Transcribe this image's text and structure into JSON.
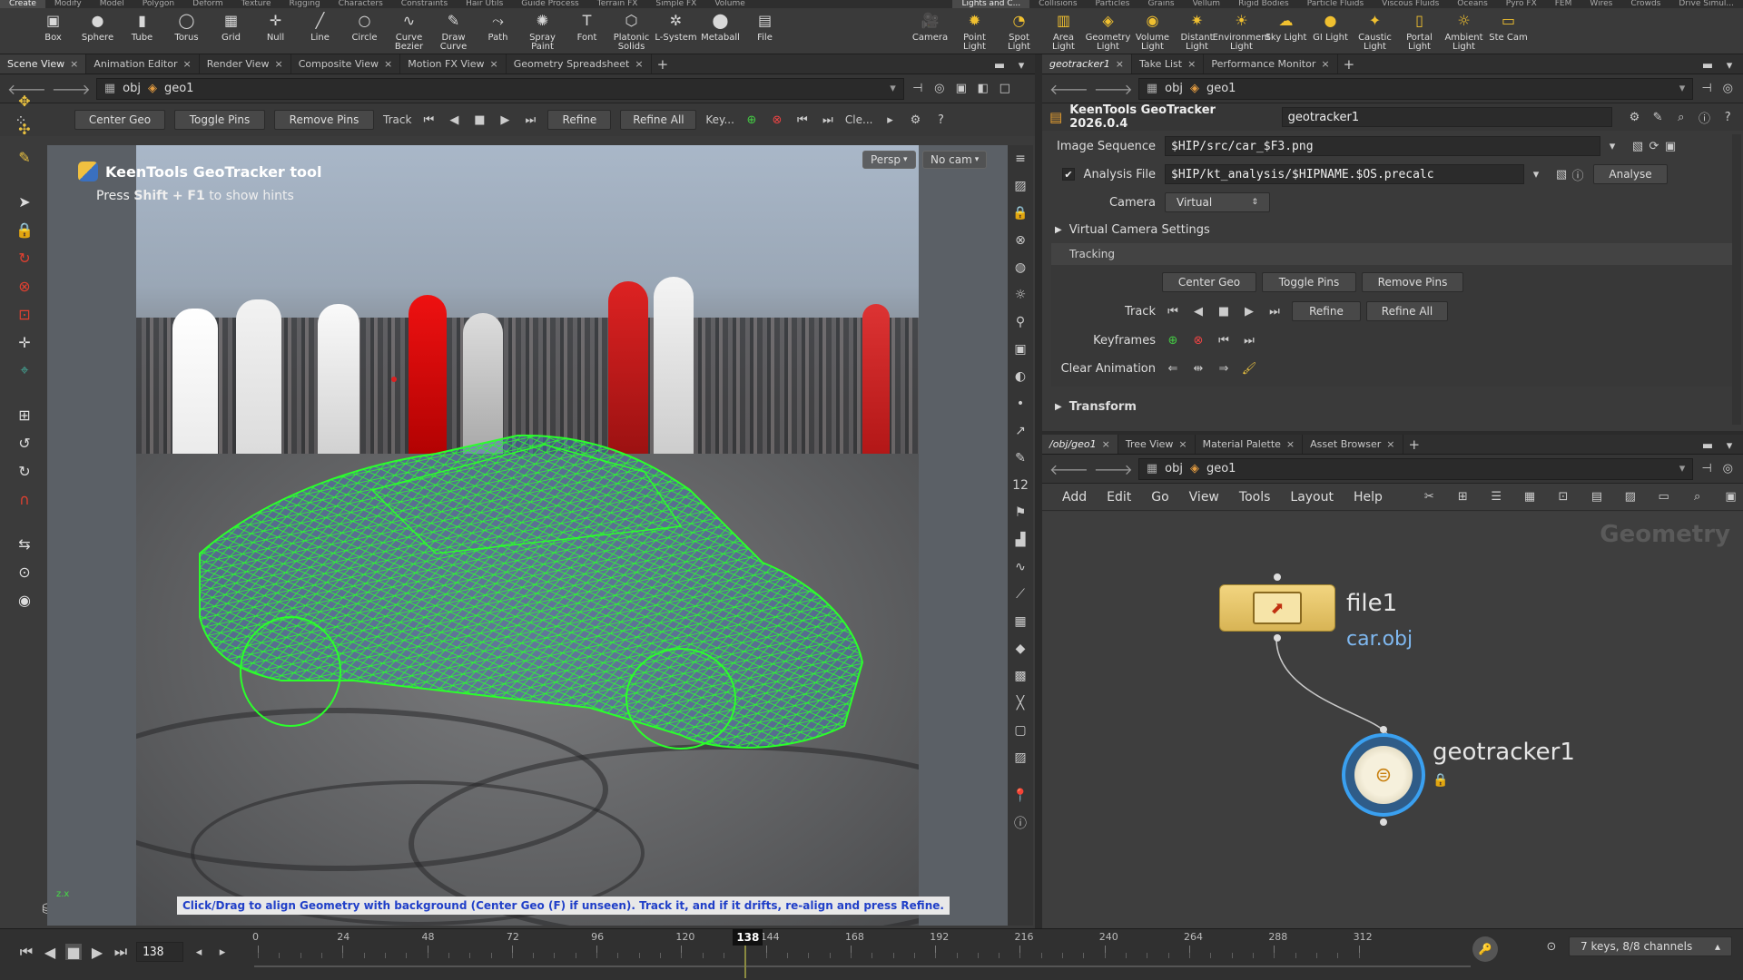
{
  "shelf": {
    "tabs_left": [
      "Create",
      "Modify",
      "Model",
      "Polygon",
      "Deform",
      "Texture",
      "Rigging",
      "Characters",
      "Constraints",
      "Hair Utils",
      "Guide Process",
      "Terrain FX",
      "Simple FX",
      "Volume"
    ],
    "tabs_right": [
      "Lights and C...",
      "Collisions",
      "Particles",
      "Grains",
      "Vellum",
      "Rigid Bodies",
      "Particle Fluids",
      "Viscous Fluids",
      "Oceans",
      "Pyro FX",
      "FEM",
      "Wires",
      "Crowds",
      "Drive Simul..."
    ],
    "tools_left": [
      "Box",
      "Sphere",
      "Tube",
      "Torus",
      "Grid",
      "Null",
      "Line",
      "Circle",
      "Curve Bezier",
      "Draw Curve",
      "Path",
      "Spray Paint",
      "Font",
      "Platonic Solids",
      "L-System",
      "Metaball",
      "File"
    ],
    "tools_right": [
      "Camera",
      "Point Light",
      "Spot Light",
      "Area Light",
      "Geometry Light",
      "Volume Light",
      "Distant Light",
      "Environment Light",
      "Sky Light",
      "GI Light",
      "Caustic Light",
      "Portal Light",
      "Ambient Light",
      "Ste Cam"
    ]
  },
  "viewport_pane": {
    "tabs": [
      "Scene View",
      "Animation Editor",
      "Render View",
      "Composite View",
      "Motion FX View",
      "Geometry Spreadsheet"
    ],
    "path_root": "obj",
    "path_node": "geo1",
    "toolbar": {
      "center_geo": "Center Geo",
      "toggle_pins": "Toggle Pins",
      "remove_pins": "Remove Pins",
      "track": "Track",
      "refine": "Refine",
      "refine_all": "Refine All",
      "key": "Key...",
      "clear": "Cle..."
    },
    "hud_title": "KeenTools GeoTracker tool",
    "hud_hint_press": "Press",
    "hud_hint_key": "Shift + F1",
    "hud_hint_rest": "to show hints",
    "persp": "Persp",
    "no_cam": "No cam",
    "status_message": "Click/Drag to align Geometry with background (Center Geo (F) if unseen). Track it, and if it drifts, re-align and press Refine.",
    "axis_label": "z.x"
  },
  "params_pane": {
    "tabs": [
      "geotracker1",
      "Take List",
      "Performance Monitor"
    ],
    "path_root": "obj",
    "path_node": "geo1",
    "node_type": "KeenTools GeoTracker 2026.0.4",
    "node_name": "geotracker1",
    "image_sequence_label": "Image Sequence",
    "image_sequence_value": "$HIP/src/car_$F3.png",
    "analysis_file_label": "Analysis File",
    "analysis_file_value": "$HIP/kt_analysis/$HIPNAME.$OS.precalc",
    "analyse_button": "Analyse",
    "camera_label": "Camera",
    "camera_value": "Virtual",
    "virtual_camera_settings": "Virtual Camera Settings",
    "tracking_tab": "Tracking",
    "center_geo": "Center Geo",
    "toggle_pins": "Toggle Pins",
    "remove_pins": "Remove Pins",
    "track_label": "Track",
    "refine": "Refine",
    "refine_all": "Refine All",
    "keyframes_label": "Keyframes",
    "clear_animation_label": "Clear Animation",
    "transform": "Transform"
  },
  "network_pane": {
    "tabs": [
      "/obj/geo1",
      "Tree View",
      "Material Palette",
      "Asset Browser"
    ],
    "path_root": "obj",
    "path_node": "geo1",
    "menu": [
      "Add",
      "Edit",
      "Go",
      "View",
      "Tools",
      "Layout",
      "Help"
    ],
    "context_label": "Geometry",
    "node_file_name": "file1",
    "node_file_sub": "car.obj",
    "node_tracker_name": "geotracker1"
  },
  "timeline": {
    "current_frame": "138",
    "ticks": [
      "0",
      "24",
      "48",
      "72",
      "96",
      "120",
      "144",
      "168",
      "192",
      "216",
      "240",
      "264",
      "288",
      "312"
    ],
    "keys_status": "7 keys, 8/8 channels"
  },
  "colors": {
    "wireframe": "#2bff2b",
    "status_text": "#2140c8",
    "accent_orange": "#f0a020",
    "node_file": "#e8c870",
    "node_tracker_ring": "#3aa0f0"
  }
}
